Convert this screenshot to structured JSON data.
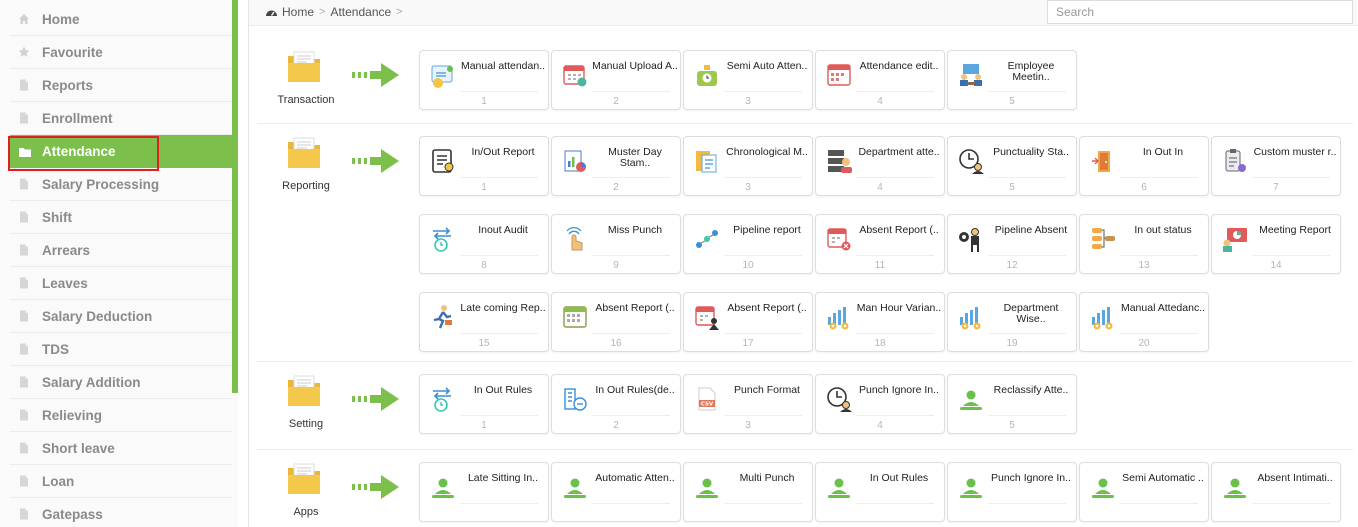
{
  "sidebar": {
    "items": [
      {
        "label": "Home",
        "icon": "home-icon"
      },
      {
        "label": "Favourite",
        "icon": "star-icon"
      },
      {
        "label": "Reports",
        "icon": "document-icon"
      },
      {
        "label": "Enrollment",
        "icon": "document-icon"
      },
      {
        "label": "Attendance",
        "icon": "folder-icon",
        "active": true
      },
      {
        "label": "Salary Processing",
        "icon": "document-icon"
      },
      {
        "label": "Shift",
        "icon": "document-icon"
      },
      {
        "label": "Arrears",
        "icon": "document-icon"
      },
      {
        "label": "Leaves",
        "icon": "document-icon"
      },
      {
        "label": "Salary Deduction",
        "icon": "document-icon"
      },
      {
        "label": "TDS",
        "icon": "document-icon"
      },
      {
        "label": "Salary Addition",
        "icon": "document-icon"
      },
      {
        "label": "Relieving",
        "icon": "document-icon"
      },
      {
        "label": "Short leave",
        "icon": "document-icon"
      },
      {
        "label": "Loan",
        "icon": "document-icon"
      },
      {
        "label": "Gatepass",
        "icon": "document-icon"
      }
    ]
  },
  "breadcrumb": {
    "home": "Home",
    "current": "Attendance",
    "sep": ">"
  },
  "search": {
    "placeholder": "Search",
    "value": ""
  },
  "colors": {
    "accent": "#7cc04b",
    "highlight_border": "#e02020",
    "folder": "#f4c84a"
  },
  "sections": [
    {
      "label": "Transaction",
      "tiles": [
        {
          "label": "Manual attendan..",
          "num": "1",
          "icon": "manual-attendance-icon"
        },
        {
          "label": "Manual Upload A..",
          "num": "2",
          "icon": "calendar-upload-icon"
        },
        {
          "label": "Semi Auto Atten..",
          "num": "3",
          "icon": "timer-icon"
        },
        {
          "label": "Attendance edit..",
          "num": "4",
          "icon": "calendar-edit-icon"
        },
        {
          "label": "Employee Meetin..",
          "num": "5",
          "icon": "meeting-icon"
        }
      ]
    },
    {
      "label": "Reporting",
      "tiles": [
        {
          "label": "In/Out Report",
          "num": "1",
          "icon": "report-icon"
        },
        {
          "label": "Muster Day Stam..",
          "num": "2",
          "icon": "chart-report-icon"
        },
        {
          "label": "Chronological M..",
          "num": "3",
          "icon": "chronological-icon"
        },
        {
          "label": "Department atte..",
          "num": "4",
          "icon": "department-icon"
        },
        {
          "label": "Punctuality Sta..",
          "num": "5",
          "icon": "punctuality-icon"
        },
        {
          "label": "In Out In",
          "num": "6",
          "icon": "door-icon"
        },
        {
          "label": "Custom muster r..",
          "num": "7",
          "icon": "clipboard-icon"
        },
        {
          "label": "Inout Audit",
          "num": "8",
          "icon": "clock-swap-icon"
        },
        {
          "label": "Miss Punch",
          "num": "9",
          "icon": "finger-touch-icon"
        },
        {
          "label": "Pipeline report",
          "num": "10",
          "icon": "pipeline-icon"
        },
        {
          "label": "Absent Report (..",
          "num": "11",
          "icon": "calendar-absent-icon"
        },
        {
          "label": "Pipeline Absent",
          "num": "12",
          "icon": "person-gear-icon"
        },
        {
          "label": "In out status",
          "num": "13",
          "icon": "network-icon"
        },
        {
          "label": "Meeting Report",
          "num": "14",
          "icon": "presentation-icon"
        },
        {
          "label": "Late coming Rep..",
          "num": "15",
          "icon": "running-man-icon"
        },
        {
          "label": "Absent Report (..",
          "num": "16",
          "icon": "calendar-grid-icon"
        },
        {
          "label": "Absent Report (..",
          "num": "17",
          "icon": "calendar-person-icon"
        },
        {
          "label": "Man Hour Varian..",
          "num": "18",
          "icon": "bar-gear-icon"
        },
        {
          "label": "Department Wise..",
          "num": "19",
          "icon": "bar-gear-icon"
        },
        {
          "label": "Manual Attedanc..",
          "num": "20",
          "icon": "bar-gear-icon"
        }
      ]
    },
    {
      "label": "Setting",
      "tiles": [
        {
          "label": "In Out Rules",
          "num": "1",
          "icon": "clock-swap-icon"
        },
        {
          "label": "In Out Rules(de..",
          "num": "2",
          "icon": "building-icon"
        },
        {
          "label": "Punch Format",
          "num": "3",
          "icon": "csv-file-icon"
        },
        {
          "label": "Punch Ignore In..",
          "num": "4",
          "icon": "punctuality-icon"
        },
        {
          "label": "Reclassify Atte..",
          "num": "5",
          "icon": "user-green-icon"
        }
      ]
    },
    {
      "label": "Apps",
      "tiles": [
        {
          "label": "Late Sitting In..",
          "num": "",
          "icon": "user-green-icon"
        },
        {
          "label": "Automatic Atten..",
          "num": "",
          "icon": "user-green-icon"
        },
        {
          "label": "Multi Punch",
          "num": "",
          "icon": "user-green-icon"
        },
        {
          "label": "In Out Rules",
          "num": "",
          "icon": "user-green-icon"
        },
        {
          "label": "Punch Ignore In..",
          "num": "",
          "icon": "user-green-icon"
        },
        {
          "label": "Semi Automatic ..",
          "num": "",
          "icon": "user-green-icon"
        },
        {
          "label": "Absent Intimati..",
          "num": "",
          "icon": "user-green-icon"
        }
      ]
    }
  ]
}
